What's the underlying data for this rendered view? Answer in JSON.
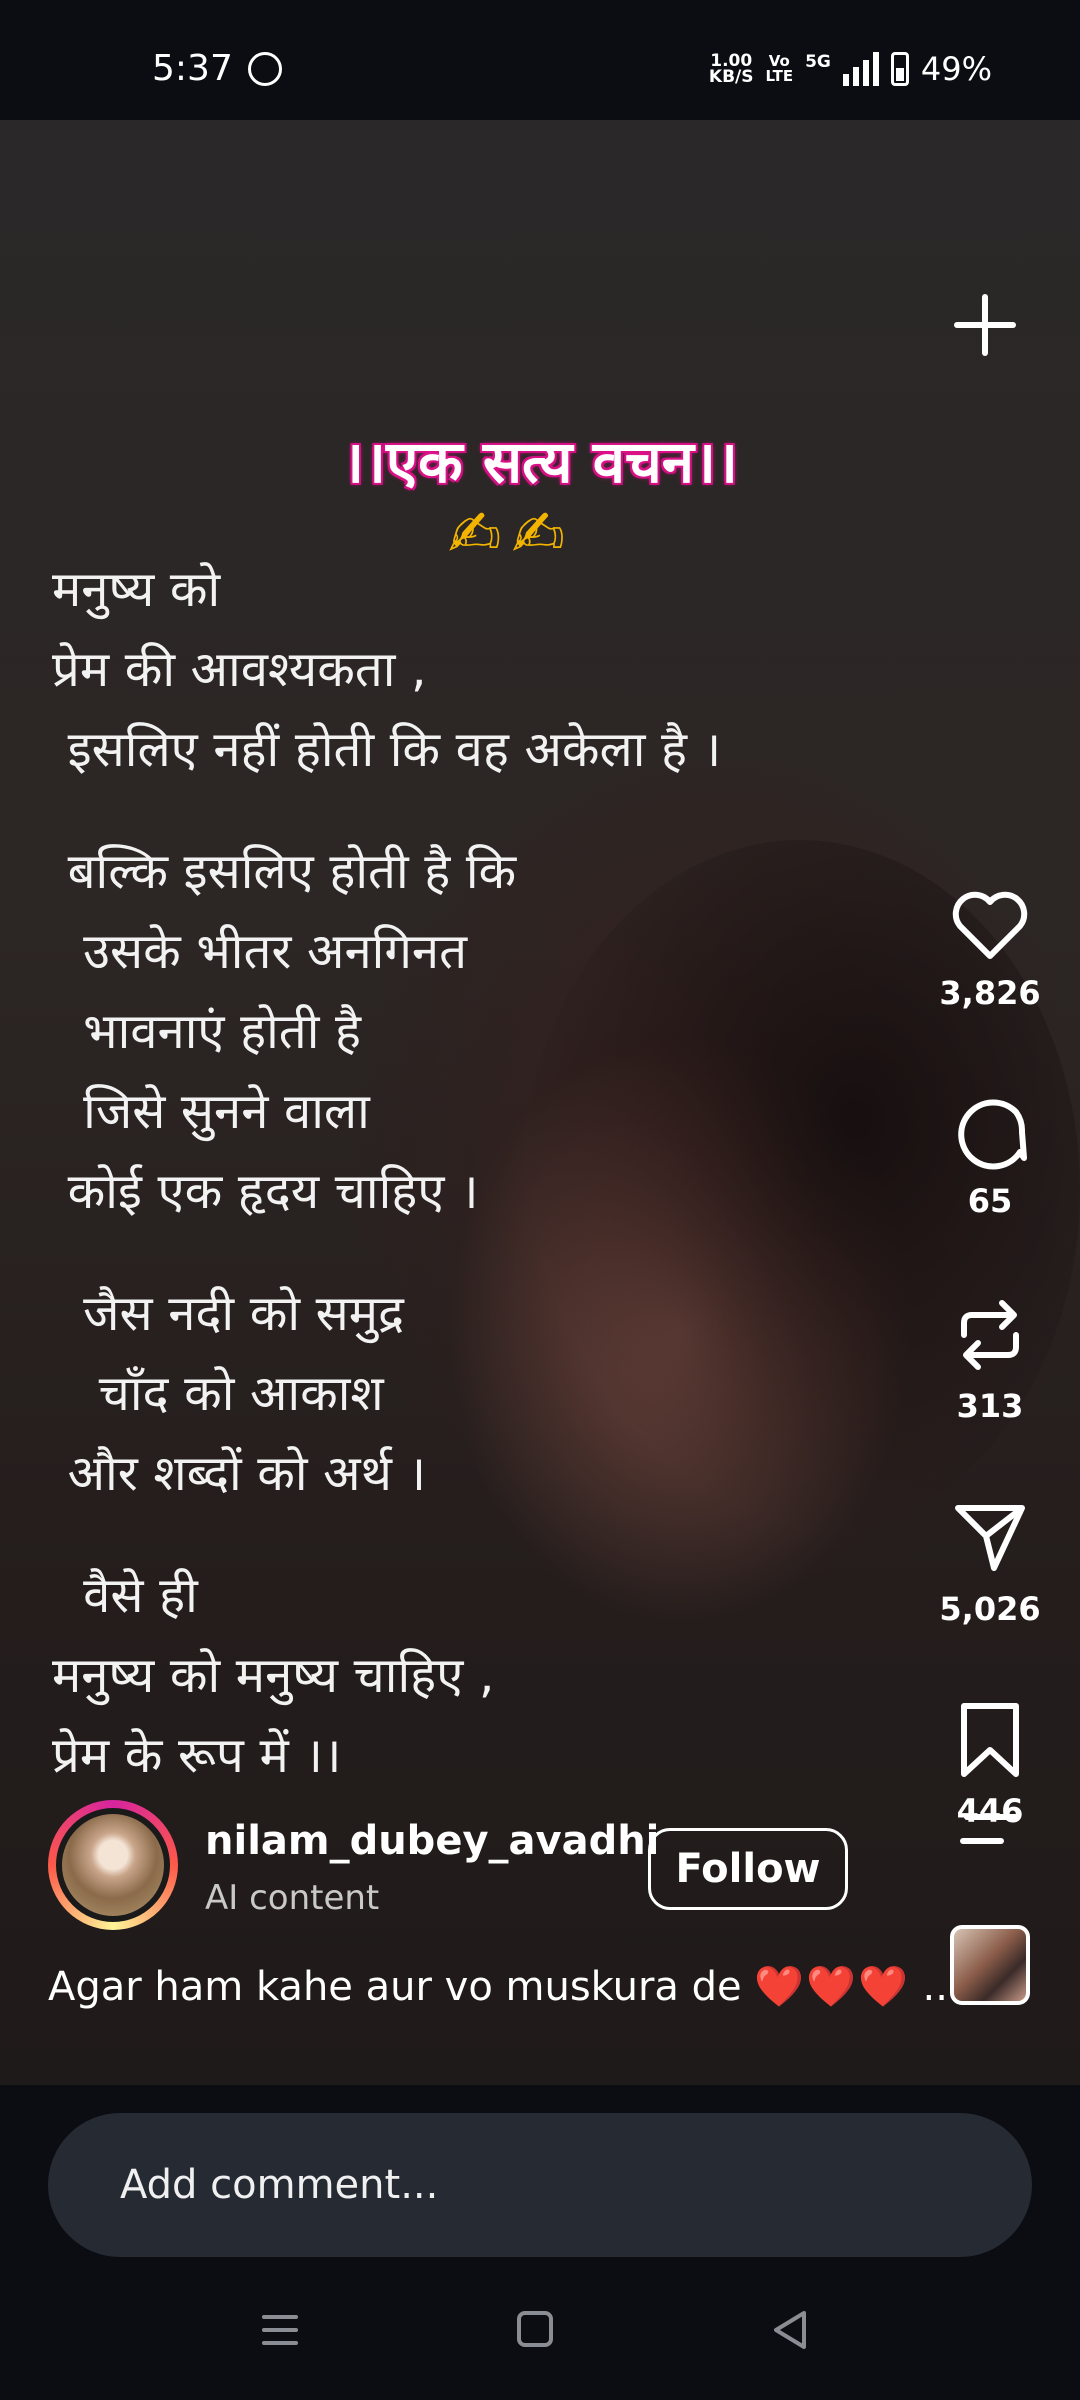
{
  "status_bar": {
    "time": "5:37",
    "net_speed_value": "1.00",
    "net_speed_unit": "KB/S",
    "volte_top": "Vo",
    "volte_bottom": "LTE",
    "network_type": "5G",
    "battery": "49%"
  },
  "post": {
    "title": "।।एक सत्य वचन।।",
    "poem_lines": [
      "मनुष्य को",
      "प्रेम की आवश्यकता ,",
      " इसलिए नहीं होती कि वह अकेला है ।",
      "",
      " बल्कि इसलिए होती है कि",
      "  उसके भीतर अनगिनत",
      "  भावनाएं होती है",
      "  जिसे सुनने वाला",
      " कोई एक हृदय चाहिए ।",
      "",
      "  जैस नदी को समुद्र",
      "   चाँद को आकाश",
      " और शब्दों को अर्थ ।",
      "",
      "  वैसे ही",
      "मनुष्य को मनुष्य चाहिए ,",
      "प्रेम के रूप में ।।"
    ]
  },
  "actions": {
    "likes": "3,826",
    "comments": "65",
    "reposts": "313",
    "shares": "5,026",
    "saves": "446"
  },
  "author": {
    "username": "nilam_dubey_avadhi",
    "label": "AI content",
    "follow_label": "Follow"
  },
  "caption": {
    "text": "Agar ham kahe aur vo muskura de",
    "hearts": "❤️❤️❤️",
    "more": "..."
  },
  "comment": {
    "placeholder": "Add comment..."
  },
  "colors": {
    "accent_pink": "#e0148c",
    "heart_red": "#e8283c",
    "background": "#0b0d12"
  }
}
